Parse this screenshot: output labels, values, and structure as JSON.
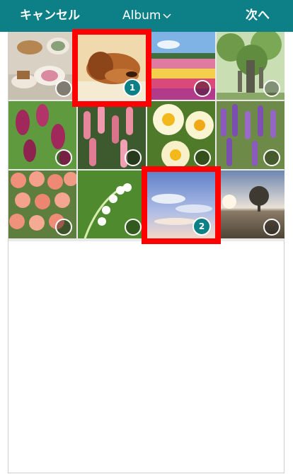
{
  "header": {
    "cancel_label": "キャンセル",
    "title": "Album",
    "next_label": "次へ",
    "background": "#0d7f86"
  },
  "photos": [
    {
      "name": "photo-tea-cakes",
      "selected": false
    },
    {
      "name": "photo-puppy",
      "selected": true,
      "order": "1"
    },
    {
      "name": "photo-flower-field",
      "selected": false
    },
    {
      "name": "photo-tree",
      "selected": false
    },
    {
      "name": "photo-lilac",
      "selected": false
    },
    {
      "name": "photo-pink-flowers",
      "selected": false
    },
    {
      "name": "photo-daffodils",
      "selected": false
    },
    {
      "name": "photo-lavender",
      "selected": false
    },
    {
      "name": "photo-carnations",
      "selected": false
    },
    {
      "name": "photo-lily-of-the-valley",
      "selected": false
    },
    {
      "name": "photo-sky",
      "selected": true,
      "order": "2"
    },
    {
      "name": "photo-sunset-tree",
      "selected": false
    }
  ],
  "accent_color": "#0d7f86",
  "highlight_color": "#ff0000"
}
